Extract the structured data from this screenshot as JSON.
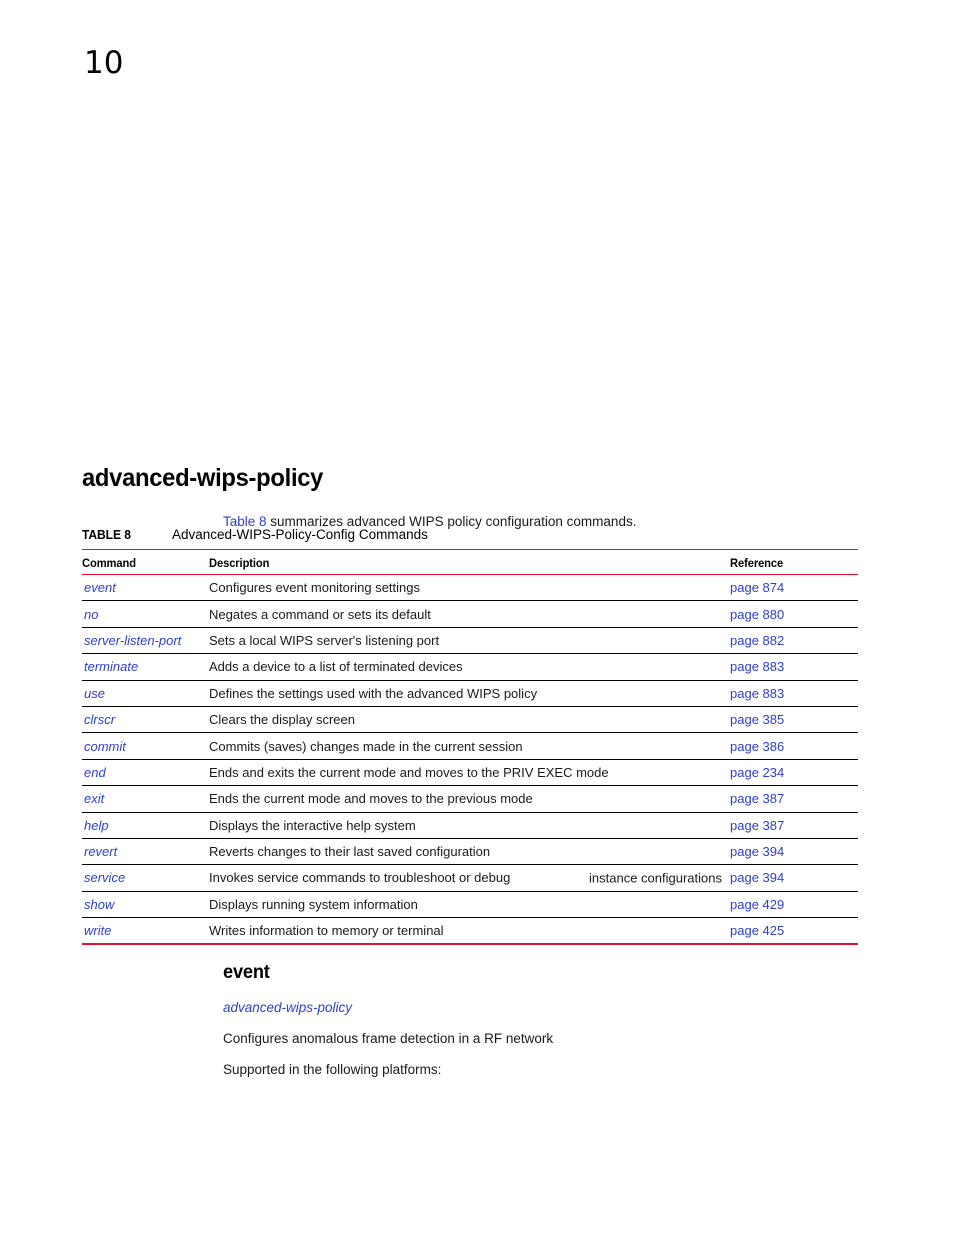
{
  "page": {
    "chapter_number": "10"
  },
  "heading": {
    "title": "advanced-wips-policy"
  },
  "intro": {
    "link_text": "Table 8",
    "rest": " summarizes advanced WIPS policy configuration commands."
  },
  "table_caption": {
    "label": "TABLE 8",
    "text": "Advanced-WIPS-Policy-Config Commands"
  },
  "table": {
    "columns": [
      "Command",
      "Description",
      "Reference"
    ],
    "rows": [
      {
        "command": "event",
        "description": "Configures event monitoring settings",
        "extra": "",
        "reference": "page 874"
      },
      {
        "command": "no",
        "description": "Negates a command or sets its default",
        "extra": "",
        "reference": "page 880"
      },
      {
        "command": "server-listen-port",
        "description": "Sets a local WIPS server's listening port",
        "extra": "",
        "reference": "page 882"
      },
      {
        "command": "terminate",
        "description": "Adds a device to a list of terminated devices",
        "extra": "",
        "reference": "page 883"
      },
      {
        "command": "use",
        "description": "Defines the settings used with the advanced WIPS policy",
        "extra": "",
        "reference": "page 883"
      },
      {
        "command": "clrscr",
        "description": "Clears the display screen",
        "extra": "",
        "reference": "page 385"
      },
      {
        "command": "commit",
        "description": "Commits (saves) changes made in the current session",
        "extra": "",
        "reference": "page 386"
      },
      {
        "command": "end",
        "description": "Ends and exits the current mode and moves to the PRIV EXEC mode",
        "extra": "",
        "reference": "page 234"
      },
      {
        "command": "exit",
        "description": "Ends the current mode and moves to the previous mode",
        "extra": "",
        "reference": "page 387"
      },
      {
        "command": "help",
        "description": "Displays the interactive help system",
        "extra": "",
        "reference": "page 387"
      },
      {
        "command": "revert",
        "description": "Reverts changes to their last saved configuration",
        "extra": "",
        "reference": "page 394"
      },
      {
        "command": "service",
        "description": "Invokes service commands to troubleshoot or debug",
        "extra": "instance configurations",
        "reference": "page 394"
      },
      {
        "command": "show",
        "description": "Displays running system information",
        "extra": "",
        "reference": "page 429"
      },
      {
        "command": "write",
        "description": "Writes information to memory or terminal",
        "extra": "",
        "reference": "page 425"
      }
    ]
  },
  "section": {
    "heading": "event",
    "mode": "advanced-wips-policy",
    "lines": [
      "Configures anomalous frame detection in a RF network",
      "Supported in the following platforms:"
    ]
  },
  "colors": {
    "link": "#2c3ed6",
    "rule_red": "#e8112d",
    "rule_black": "#000000",
    "text": "#1a1a1a"
  }
}
